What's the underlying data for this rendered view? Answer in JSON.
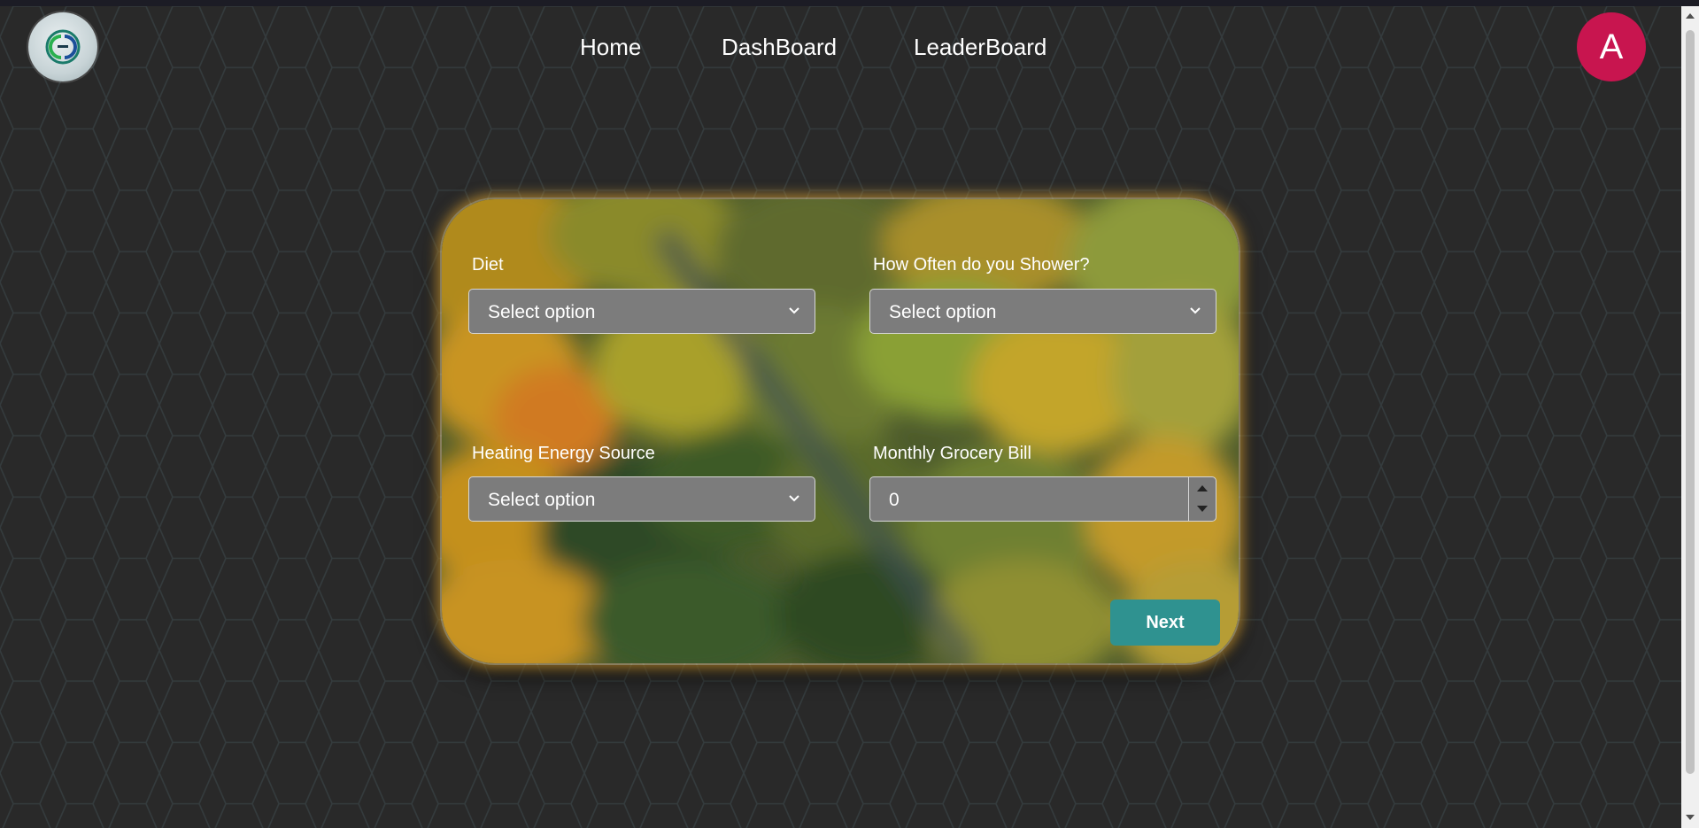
{
  "nav": {
    "items": [
      {
        "label": "Home"
      },
      {
        "label": "DashBoard"
      },
      {
        "label": "LeaderBoard"
      }
    ]
  },
  "avatar": {
    "initial": "A",
    "color": "#c8154f"
  },
  "form": {
    "fields": [
      {
        "label": "Diet",
        "value": "Select option",
        "type": "select"
      },
      {
        "label": "How Often do you Shower?",
        "value": "Select option",
        "type": "select"
      },
      {
        "label": "Heating Energy Source",
        "value": "Select option",
        "type": "select"
      },
      {
        "label": "Monthly Grocery Bill",
        "value": "0",
        "type": "number"
      }
    ],
    "next_label": "Next",
    "accent": "#2f9290"
  },
  "icons": {
    "logo": "logo-icon",
    "select_chevron": "chevron-down-icon",
    "spin_up": "spin-up-icon",
    "spin_down": "spin-down-icon"
  }
}
